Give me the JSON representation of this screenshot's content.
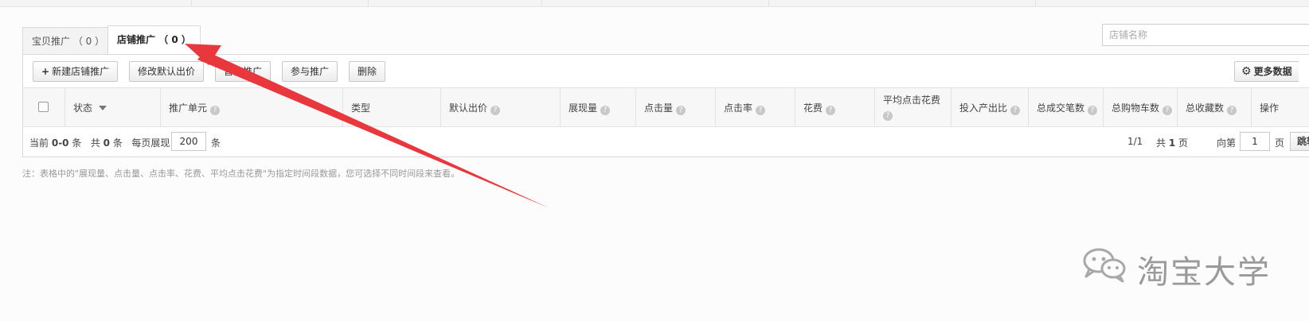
{
  "tabs": [
    {
      "label": "宝贝推广 （ 0 ）",
      "active": false
    },
    {
      "label": "店铺推广 （ 0 ）",
      "active": true
    }
  ],
  "search": {
    "placeholder": "店铺名称"
  },
  "toolbar": {
    "new_store_promo": "新建店铺推广",
    "edit_default_bid": "修改默认出价",
    "pause": "暂停推广",
    "join": "参与推广",
    "delete": "删除",
    "more_data": "更多数据"
  },
  "table": {
    "columns": [
      {
        "label": "状态"
      },
      {
        "label": "推广单元"
      },
      {
        "label": "类型"
      },
      {
        "label": "默认出价"
      },
      {
        "label": "展现量"
      },
      {
        "label": "点击量"
      },
      {
        "label": "点击率"
      },
      {
        "label": "花费"
      },
      {
        "label": "平均点击花费"
      },
      {
        "label": "投入产出比"
      },
      {
        "label": "总成交笔数"
      },
      {
        "label": "总购物车数"
      },
      {
        "label": "总收藏数"
      },
      {
        "label": "操作"
      }
    ]
  },
  "pager": {
    "current_prefix": "当前",
    "current_range": "0-0",
    "unit": "条",
    "total_prefix": "共",
    "total": "0",
    "per_page_label": "每页展现",
    "per_page": "200",
    "page_status": "1/1",
    "pages_prefix": "共",
    "pages": "1",
    "pages_unit": "页",
    "goto_prefix": "向第",
    "goto_value": "1",
    "goto_unit": "页",
    "jump_button": "跳转"
  },
  "note": "注：表格中的\"展现量、点击量、点击率、花费、平均点击花费\"为指定时间段数据，您可选择不同时间段来查看。",
  "watermark": {
    "text": "淘宝大学",
    "icon": "wechat-icon"
  },
  "colors": {
    "arrow": "#e8383d",
    "header_bg": "#f7f7f7",
    "border": "#d9d9d9"
  }
}
